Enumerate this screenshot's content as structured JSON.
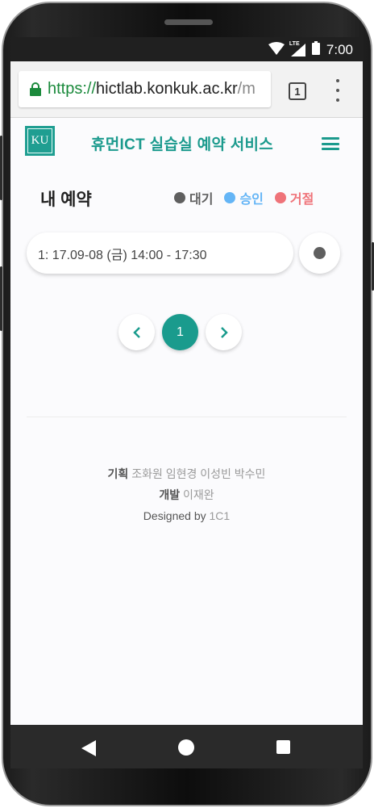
{
  "status_bar": {
    "time": "7:00",
    "network": "LTE"
  },
  "browser": {
    "url_scheme": "https://",
    "url_host": "hictlab.konkuk.ac.kr",
    "url_path": "/m",
    "tab_count": "1"
  },
  "header": {
    "logo_text": "KU",
    "title": "휴먼ICT 실습실 예약 서비스"
  },
  "reservations": {
    "title": "내 예약",
    "legend": [
      {
        "label": "대기",
        "color": "#5f5f5f"
      },
      {
        "label": "승인",
        "color": "#64b5f6"
      },
      {
        "label": "거절",
        "color": "#ef7379"
      }
    ],
    "items": [
      {
        "text": "1: 17.09-08 (금) 14:00 - 17:30",
        "status_color": "#5f5f5f"
      }
    ]
  },
  "pagination": {
    "pages": [
      "1"
    ],
    "current": "1"
  },
  "footer": {
    "planning_label": "기획",
    "planning_names": "조화원 임현경 이성빈 박수민",
    "dev_label": "개발",
    "dev_name": "이재완",
    "designed_by_label": "Designed by",
    "designed_by_name": "1C1"
  },
  "colors": {
    "accent": "#1b9a8d"
  }
}
